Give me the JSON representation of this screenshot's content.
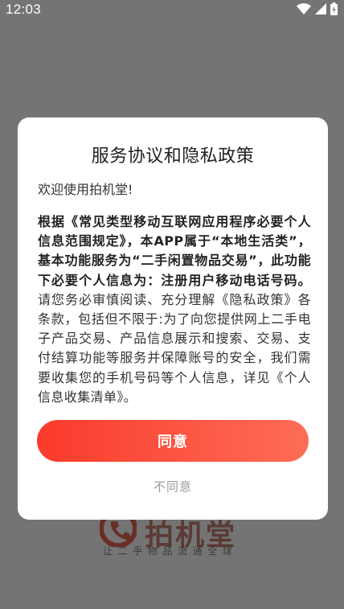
{
  "status_bar": {
    "time": "12:03",
    "icons": [
      "wifi-icon",
      "signal-icon",
      "battery-icon"
    ]
  },
  "background": {
    "logo_text": "拍机堂",
    "slogan": "让二手物品流通全球",
    "logo_color": "#c0392b"
  },
  "dialog": {
    "title": "服务协议和隐私政策",
    "welcome": "欢迎使用拍机堂!",
    "bold_paragraph": "根据《常见类型移动互联网应用程序必要个人信息范围规定》，本APP属于“本地生活类”，基本功能服务为“二手闲置物品交易”，此功能下必要个人信息为：注册用户移动电话号码。",
    "normal_paragraph": "请您务必审慎阅读、充分理解《隐私政策》各条款，包括但不限于:为了向您提供网上二手电子产品交易、产品信息展示和搜索、交易、支付结算功能等服务并保障账号的安全，我们需要收集您的手机号码等个人信息，详见《个人信息收集清单》。",
    "agree_label": "同意",
    "disagree_label": "不同意"
  },
  "colors": {
    "accent_start": "#fa3a2b",
    "accent_end": "#fd6d57",
    "overlay": "#747474"
  }
}
